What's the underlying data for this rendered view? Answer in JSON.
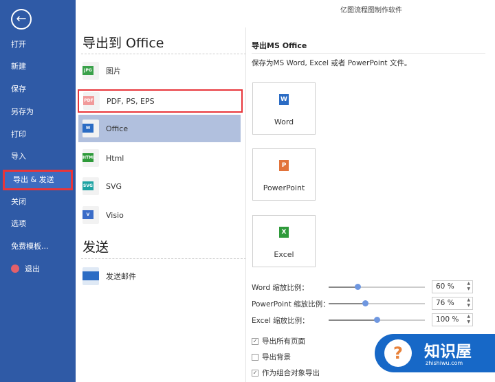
{
  "window": {
    "title": "亿图流程图制作软件"
  },
  "sidebar": {
    "items": [
      {
        "label": "打开"
      },
      {
        "label": "新建"
      },
      {
        "label": "保存"
      },
      {
        "label": "另存为"
      },
      {
        "label": "打印"
      },
      {
        "label": "导入"
      },
      {
        "label": "导出 & 发送",
        "active": true
      },
      {
        "label": "关闭"
      },
      {
        "label": "选项"
      },
      {
        "label": "免费模板..."
      },
      {
        "label": "退出",
        "icon": "exit-icon"
      }
    ]
  },
  "middle": {
    "export_heading": "导出到 Office",
    "items": [
      {
        "label": "图片",
        "icon": "JPG",
        "color": "#3aa14a"
      },
      {
        "label": "PDF, PS, EPS",
        "icon": "PDF",
        "color": "#f19a9a"
      },
      {
        "label": "Office",
        "icon": "W",
        "color": "#2b6cc4"
      },
      {
        "label": "Html",
        "icon": "HTML",
        "color": "#2e9a3a"
      },
      {
        "label": "SVG",
        "icon": "SVG",
        "color": "#1fa3a3"
      },
      {
        "label": "Visio",
        "icon": "V",
        "color": "#3a6cc8"
      }
    ],
    "send_heading": "发送",
    "send_items": [
      {
        "label": "发送邮件"
      }
    ]
  },
  "right": {
    "heading": "导出MS Office",
    "description": "保存为MS Word, Excel 或者 PowerPoint 文件。",
    "cards": [
      {
        "label": "Word",
        "letter": "W",
        "color": "#2b6cc4"
      },
      {
        "label": "PowerPoint",
        "letter": "P",
        "color": "#e2733a"
      },
      {
        "label": "Excel",
        "letter": "X",
        "color": "#2e9a3a"
      }
    ],
    "scales": [
      {
        "label": "Word 缩放比例：",
        "value": "60 %",
        "level": 0.3
      },
      {
        "label": "PowerPoint 缩放比例：",
        "value": "76 %",
        "level": 0.38
      },
      {
        "label": "Excel 缩放比例：",
        "value": "100 %",
        "level": 0.5
      }
    ],
    "checkboxes": [
      {
        "label": "导出所有页面",
        "checked": true
      },
      {
        "label": "导出背景",
        "checked": false
      },
      {
        "label": "作为组合对象导出",
        "checked": true
      }
    ]
  },
  "watermark": {
    "name": "知识屋",
    "url": "zhishiwu.com"
  }
}
